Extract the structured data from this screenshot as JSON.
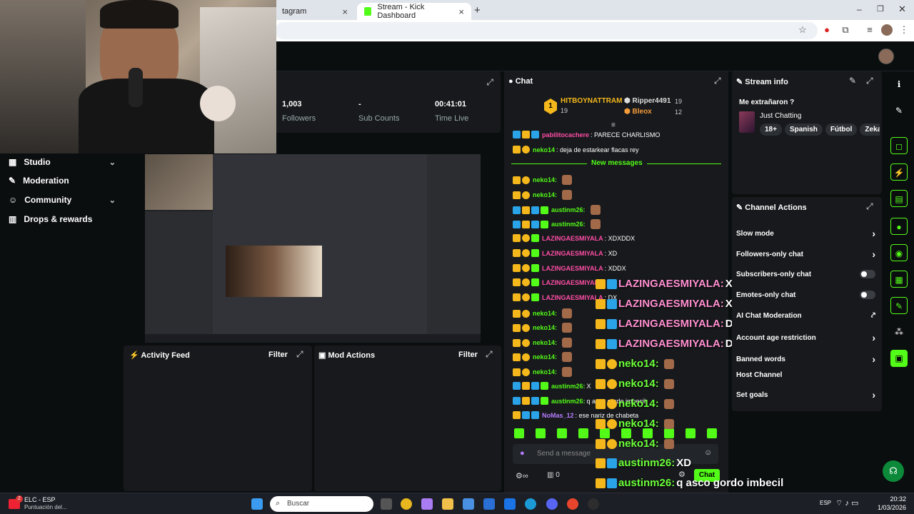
{
  "browser": {
    "tabs": [
      {
        "label": "tagram"
      },
      {
        "label": "Stream - Kick Dashboard"
      }
    ]
  },
  "sidebar": {
    "items": [
      {
        "label": "Studio",
        "icon": "grid-icon",
        "chevron": true
      },
      {
        "label": "Moderation",
        "icon": "wrench-icon",
        "chevron": false
      },
      {
        "label": "Community",
        "icon": "users-icon",
        "chevron": true
      },
      {
        "label": "Drops & rewards",
        "icon": "chart-icon",
        "chevron": false
      }
    ]
  },
  "stats": [
    {
      "value": "1,003",
      "label": "Followers"
    },
    {
      "value": "-",
      "label": "Sub Counts"
    },
    {
      "value": "00:41:01",
      "label": "Time Live"
    }
  ],
  "activity_feed": {
    "title": "Activity Feed",
    "filter": "Filter"
  },
  "mod_actions": {
    "title": "Mod Actions",
    "filter": "Filter"
  },
  "chat": {
    "title": "Chat",
    "leaderboard": {
      "first": {
        "rank": "1",
        "name": "HITBOYNATTRAM",
        "count": "19"
      },
      "second": {
        "name": "Ripper4491",
        "count": "19"
      },
      "third": {
        "name": "Bleox",
        "count": "12"
      }
    },
    "new_messages": "New messages",
    "messages": [
      {
        "user": "pabilitocachere",
        "text": ": PARECE CHARLISMO",
        "color": "#ff4da6"
      },
      {
        "user": "neko14",
        "text": ": deja de estarkear flacas rey",
        "color": "#53fc18"
      },
      {
        "user": "neko14:",
        "text": "",
        "color": "#53fc18"
      },
      {
        "user": "neko14:",
        "text": "",
        "color": "#53fc18"
      },
      {
        "user": "austinm26:",
        "text": "",
        "color": "#53fc18"
      },
      {
        "user": "austinm26:",
        "text": "",
        "color": "#53fc18"
      },
      {
        "user": "LAZINGAESMIYALA",
        "text": ": XDXDDX",
        "color": "#ff4da6"
      },
      {
        "user": "LAZINGAESMIYALA",
        "text": ": XD",
        "color": "#ff4da6"
      },
      {
        "user": "LAZINGAESMIYALA",
        "text": ": XDDX",
        "color": "#ff4da6"
      },
      {
        "user": "LAZINGAESMIYALA",
        "text": "",
        "color": "#ff4da6"
      },
      {
        "user": "LAZINGAESMIYALA",
        "text": ": DX",
        "color": "#ff4da6"
      },
      {
        "user": "neko14:",
        "text": "",
        "color": "#53fc18"
      },
      {
        "user": "neko14:",
        "text": "",
        "color": "#53fc18"
      },
      {
        "user": "neko14:",
        "text": "",
        "color": "#53fc18"
      },
      {
        "user": "neko14:",
        "text": "",
        "color": "#53fc18"
      },
      {
        "user": "neko14:",
        "text": "",
        "color": "#53fc18"
      },
      {
        "user": "austinm26:",
        "text": " X",
        "color": "#53fc18"
      },
      {
        "user": "austinm26:",
        "text": " q asco gordo imbecil",
        "color": "#53fc18"
      },
      {
        "user": "NoMas_12",
        "text": ": ese nariz de chabeta",
        "color": "#b57cff"
      }
    ],
    "input_placeholder": "Send a message",
    "bottom_count": "0",
    "chat_button": "Chat"
  },
  "overlay": [
    {
      "user": "LAZINGAESMIYALA:",
      "text": " XD"
    },
    {
      "user": "LAZINGAESMIYALA:",
      "text": " XDDX"
    },
    {
      "user": "LAZINGAESMIYALA:",
      "text": " DX"
    },
    {
      "user": "LAZINGAESMIYALA:",
      "text": " DX"
    },
    {
      "user": "neko14:",
      "text": ""
    },
    {
      "user": "neko14:",
      "text": ""
    },
    {
      "user": "neko14:",
      "text": ""
    },
    {
      "user": "neko14:",
      "text": ""
    },
    {
      "user": "neko14:",
      "text": ""
    },
    {
      "user": "austinm26:",
      "text": " XD"
    },
    {
      "user": "austinm26:",
      "text": " q asco gordo imbecil"
    },
    {
      "user": "NoMas_12:",
      "text": " ese nariz de chabeta"
    }
  ],
  "stream_info": {
    "title": "Stream info",
    "stream_title": "Me extrañaron ?",
    "category": "Just Chatting",
    "tags": [
      "18+",
      "Spanish",
      "Fútbol",
      "Zekag"
    ]
  },
  "channel_actions": {
    "title": "Channel Actions",
    "items": [
      {
        "label": "Slow mode",
        "control": "chevron"
      },
      {
        "label": "Followers-only chat",
        "control": "chevron"
      },
      {
        "label": "Subscribers-only chat",
        "control": "toggle"
      },
      {
        "label": "Emotes-only chat",
        "control": "toggle"
      },
      {
        "label": "AI Chat Moderation",
        "control": "external"
      },
      {
        "label": "Account age restriction",
        "control": "chevron"
      },
      {
        "label": "Banned words",
        "control": "chevron"
      },
      {
        "label": "Host Channel",
        "control": "none"
      },
      {
        "label": "Set goals",
        "control": "chevron"
      }
    ]
  },
  "taskbar": {
    "weather_title": "ELC - ESP",
    "weather_sub": "Puntuación del...",
    "search": "Buscar",
    "lang": "ESP",
    "time": "20:32",
    "date": "1/03/2026",
    "notif": "2"
  },
  "colors": {
    "accent": "#53fc18",
    "panel": "#17191c",
    "bg": "#0b0e0f"
  }
}
